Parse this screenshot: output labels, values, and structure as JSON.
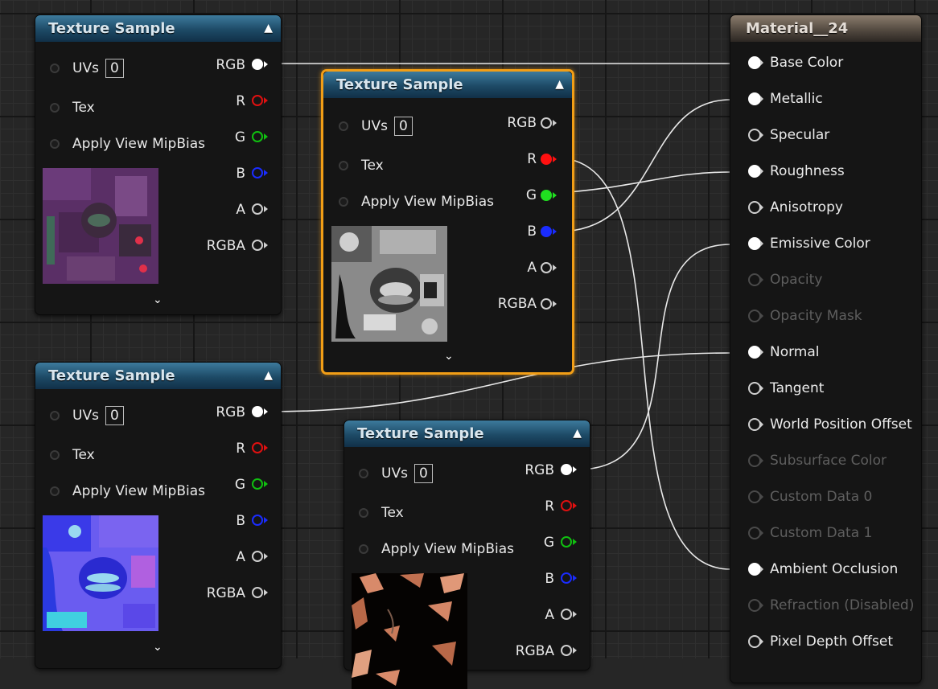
{
  "nodes": [
    {
      "title": "Texture Sample",
      "inputs": [
        "UVs",
        "Tex",
        "Apply View MipBias"
      ],
      "uv_value": "0",
      "outputs": [
        "RGB",
        "R",
        "G",
        "B",
        "A",
        "RGBA"
      ]
    },
    {
      "title": "Texture Sample",
      "inputs": [
        "UVs",
        "Tex",
        "Apply View MipBias"
      ],
      "uv_value": "0",
      "outputs": [
        "RGB",
        "R",
        "G",
        "B",
        "A",
        "RGBA"
      ],
      "selected": true
    },
    {
      "title": "Texture Sample",
      "inputs": [
        "UVs",
        "Tex",
        "Apply View MipBias"
      ],
      "uv_value": "0",
      "outputs": [
        "RGB",
        "R",
        "G",
        "B",
        "A",
        "RGBA"
      ]
    },
    {
      "title": "Texture Sample",
      "inputs": [
        "UVs",
        "Tex",
        "Apply View MipBias"
      ],
      "uv_value": "0",
      "outputs": [
        "RGB",
        "R",
        "G",
        "B",
        "A",
        "RGBA"
      ]
    }
  ],
  "material": {
    "title": "Material__24",
    "inputs": [
      {
        "label": "Base Color",
        "active": true,
        "connected": true
      },
      {
        "label": "Metallic",
        "active": true,
        "connected": true
      },
      {
        "label": "Specular",
        "active": true,
        "connected": false
      },
      {
        "label": "Roughness",
        "active": true,
        "connected": true
      },
      {
        "label": "Anisotropy",
        "active": true,
        "connected": false
      },
      {
        "label": "Emissive Color",
        "active": true,
        "connected": true
      },
      {
        "label": "Opacity",
        "active": false,
        "connected": false
      },
      {
        "label": "Opacity Mask",
        "active": false,
        "connected": false
      },
      {
        "label": "Normal",
        "active": true,
        "connected": true
      },
      {
        "label": "Tangent",
        "active": true,
        "connected": false
      },
      {
        "label": "World Position Offset",
        "active": true,
        "connected": false
      },
      {
        "label": "Subsurface Color",
        "active": false,
        "connected": false
      },
      {
        "label": "Custom Data 0",
        "active": false,
        "connected": false
      },
      {
        "label": "Custom Data 1",
        "active": false,
        "connected": false
      },
      {
        "label": "Ambient Occlusion",
        "active": true,
        "connected": true
      },
      {
        "label": "Refraction (Disabled)",
        "active": false,
        "connected": false
      },
      {
        "label": "Pixel Depth Offset",
        "active": true,
        "connected": false
      }
    ]
  },
  "colors": {
    "r_pin": "#e01010",
    "g_pin": "#10c010",
    "b_pin": "#1a2cff",
    "selection": "#f29e16"
  },
  "icons": {
    "collapse": "chevron-up-icon",
    "expand": "chevron-down-icon"
  }
}
